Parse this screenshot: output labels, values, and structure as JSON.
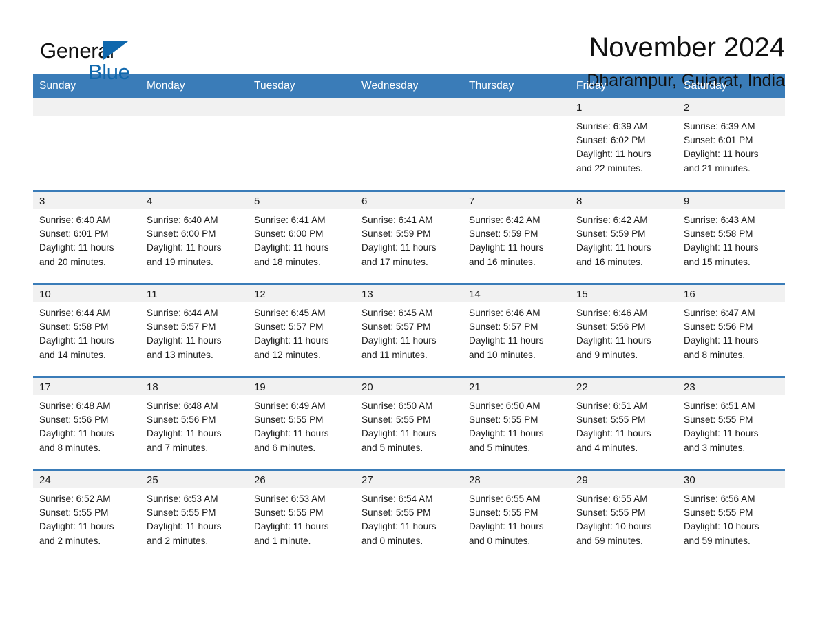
{
  "logo": {
    "word_one": "General",
    "word_two": "Blue",
    "triangle_icon": "triangle-icon",
    "accent_color": "#1068ad"
  },
  "header": {
    "month_title": "November 2024",
    "location": "Dharampur, Gujarat, India"
  },
  "theme": {
    "header_blue": "#3a7cb8",
    "daynum_band": "#f1f1f1",
    "page_background": "#ffffff"
  },
  "calendar": {
    "weekday_headers": [
      "Sunday",
      "Monday",
      "Tuesday",
      "Wednesday",
      "Thursday",
      "Friday",
      "Saturday"
    ],
    "weeks": [
      [
        {
          "day": "",
          "empty": true
        },
        {
          "day": "",
          "empty": true
        },
        {
          "day": "",
          "empty": true
        },
        {
          "day": "",
          "empty": true
        },
        {
          "day": "",
          "empty": true
        },
        {
          "day": "1",
          "sunrise": "Sunrise: 6:39 AM",
          "sunset": "Sunset: 6:02 PM",
          "daylight_line1": "Daylight: 11 hours",
          "daylight_line2": "and 22 minutes."
        },
        {
          "day": "2",
          "sunrise": "Sunrise: 6:39 AM",
          "sunset": "Sunset: 6:01 PM",
          "daylight_line1": "Daylight: 11 hours",
          "daylight_line2": "and 21 minutes."
        }
      ],
      [
        {
          "day": "3",
          "sunrise": "Sunrise: 6:40 AM",
          "sunset": "Sunset: 6:01 PM",
          "daylight_line1": "Daylight: 11 hours",
          "daylight_line2": "and 20 minutes."
        },
        {
          "day": "4",
          "sunrise": "Sunrise: 6:40 AM",
          "sunset": "Sunset: 6:00 PM",
          "daylight_line1": "Daylight: 11 hours",
          "daylight_line2": "and 19 minutes."
        },
        {
          "day": "5",
          "sunrise": "Sunrise: 6:41 AM",
          "sunset": "Sunset: 6:00 PM",
          "daylight_line1": "Daylight: 11 hours",
          "daylight_line2": "and 18 minutes."
        },
        {
          "day": "6",
          "sunrise": "Sunrise: 6:41 AM",
          "sunset": "Sunset: 5:59 PM",
          "daylight_line1": "Daylight: 11 hours",
          "daylight_line2": "and 17 minutes."
        },
        {
          "day": "7",
          "sunrise": "Sunrise: 6:42 AM",
          "sunset": "Sunset: 5:59 PM",
          "daylight_line1": "Daylight: 11 hours",
          "daylight_line2": "and 16 minutes."
        },
        {
          "day": "8",
          "sunrise": "Sunrise: 6:42 AM",
          "sunset": "Sunset: 5:59 PM",
          "daylight_line1": "Daylight: 11 hours",
          "daylight_line2": "and 16 minutes."
        },
        {
          "day": "9",
          "sunrise": "Sunrise: 6:43 AM",
          "sunset": "Sunset: 5:58 PM",
          "daylight_line1": "Daylight: 11 hours",
          "daylight_line2": "and 15 minutes."
        }
      ],
      [
        {
          "day": "10",
          "sunrise": "Sunrise: 6:44 AM",
          "sunset": "Sunset: 5:58 PM",
          "daylight_line1": "Daylight: 11 hours",
          "daylight_line2": "and 14 minutes."
        },
        {
          "day": "11",
          "sunrise": "Sunrise: 6:44 AM",
          "sunset": "Sunset: 5:57 PM",
          "daylight_line1": "Daylight: 11 hours",
          "daylight_line2": "and 13 minutes."
        },
        {
          "day": "12",
          "sunrise": "Sunrise: 6:45 AM",
          "sunset": "Sunset: 5:57 PM",
          "daylight_line1": "Daylight: 11 hours",
          "daylight_line2": "and 12 minutes."
        },
        {
          "day": "13",
          "sunrise": "Sunrise: 6:45 AM",
          "sunset": "Sunset: 5:57 PM",
          "daylight_line1": "Daylight: 11 hours",
          "daylight_line2": "and 11 minutes."
        },
        {
          "day": "14",
          "sunrise": "Sunrise: 6:46 AM",
          "sunset": "Sunset: 5:57 PM",
          "daylight_line1": "Daylight: 11 hours",
          "daylight_line2": "and 10 minutes."
        },
        {
          "day": "15",
          "sunrise": "Sunrise: 6:46 AM",
          "sunset": "Sunset: 5:56 PM",
          "daylight_line1": "Daylight: 11 hours",
          "daylight_line2": "and 9 minutes."
        },
        {
          "day": "16",
          "sunrise": "Sunrise: 6:47 AM",
          "sunset": "Sunset: 5:56 PM",
          "daylight_line1": "Daylight: 11 hours",
          "daylight_line2": "and 8 minutes."
        }
      ],
      [
        {
          "day": "17",
          "sunrise": "Sunrise: 6:48 AM",
          "sunset": "Sunset: 5:56 PM",
          "daylight_line1": "Daylight: 11 hours",
          "daylight_line2": "and 8 minutes."
        },
        {
          "day": "18",
          "sunrise": "Sunrise: 6:48 AM",
          "sunset": "Sunset: 5:56 PM",
          "daylight_line1": "Daylight: 11 hours",
          "daylight_line2": "and 7 minutes."
        },
        {
          "day": "19",
          "sunrise": "Sunrise: 6:49 AM",
          "sunset": "Sunset: 5:55 PM",
          "daylight_line1": "Daylight: 11 hours",
          "daylight_line2": "and 6 minutes."
        },
        {
          "day": "20",
          "sunrise": "Sunrise: 6:50 AM",
          "sunset": "Sunset: 5:55 PM",
          "daylight_line1": "Daylight: 11 hours",
          "daylight_line2": "and 5 minutes."
        },
        {
          "day": "21",
          "sunrise": "Sunrise: 6:50 AM",
          "sunset": "Sunset: 5:55 PM",
          "daylight_line1": "Daylight: 11 hours",
          "daylight_line2": "and 5 minutes."
        },
        {
          "day": "22",
          "sunrise": "Sunrise: 6:51 AM",
          "sunset": "Sunset: 5:55 PM",
          "daylight_line1": "Daylight: 11 hours",
          "daylight_line2": "and 4 minutes."
        },
        {
          "day": "23",
          "sunrise": "Sunrise: 6:51 AM",
          "sunset": "Sunset: 5:55 PM",
          "daylight_line1": "Daylight: 11 hours",
          "daylight_line2": "and 3 minutes."
        }
      ],
      [
        {
          "day": "24",
          "sunrise": "Sunrise: 6:52 AM",
          "sunset": "Sunset: 5:55 PM",
          "daylight_line1": "Daylight: 11 hours",
          "daylight_line2": "and 2 minutes."
        },
        {
          "day": "25",
          "sunrise": "Sunrise: 6:53 AM",
          "sunset": "Sunset: 5:55 PM",
          "daylight_line1": "Daylight: 11 hours",
          "daylight_line2": "and 2 minutes."
        },
        {
          "day": "26",
          "sunrise": "Sunrise: 6:53 AM",
          "sunset": "Sunset: 5:55 PM",
          "daylight_line1": "Daylight: 11 hours",
          "daylight_line2": "and 1 minute."
        },
        {
          "day": "27",
          "sunrise": "Sunrise: 6:54 AM",
          "sunset": "Sunset: 5:55 PM",
          "daylight_line1": "Daylight: 11 hours",
          "daylight_line2": "and 0 minutes."
        },
        {
          "day": "28",
          "sunrise": "Sunrise: 6:55 AM",
          "sunset": "Sunset: 5:55 PM",
          "daylight_line1": "Daylight: 11 hours",
          "daylight_line2": "and 0 minutes."
        },
        {
          "day": "29",
          "sunrise": "Sunrise: 6:55 AM",
          "sunset": "Sunset: 5:55 PM",
          "daylight_line1": "Daylight: 10 hours",
          "daylight_line2": "and 59 minutes."
        },
        {
          "day": "30",
          "sunrise": "Sunrise: 6:56 AM",
          "sunset": "Sunset: 5:55 PM",
          "daylight_line1": "Daylight: 10 hours",
          "daylight_line2": "and 59 minutes."
        }
      ]
    ]
  }
}
